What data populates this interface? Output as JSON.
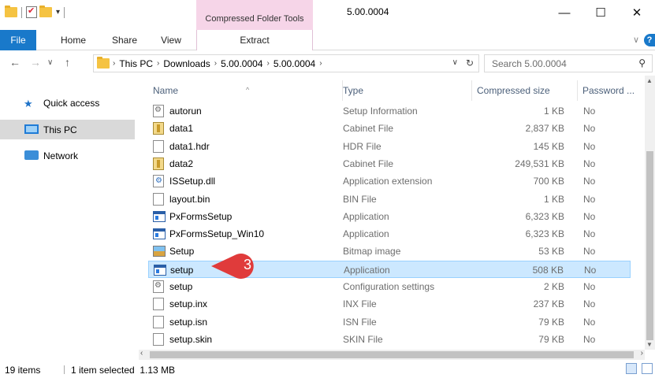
{
  "window": {
    "title": "5.00.0004",
    "context_tab": "Compressed Folder Tools",
    "minimize": "—",
    "maximize": "☐",
    "close": "✕"
  },
  "ribbon": {
    "tabs": [
      "File",
      "Home",
      "Share",
      "View",
      "Extract"
    ],
    "collapse_glyph": "∨",
    "help_glyph": "?"
  },
  "address": {
    "back": "←",
    "forward": "→",
    "recent": "∨",
    "up": "↑",
    "crumbs": [
      "This PC",
      "Downloads",
      "5.00.0004",
      "5.00.0004"
    ],
    "dropdown": "∨",
    "refresh": "↻"
  },
  "search": {
    "placeholder": "Search 5.00.0004",
    "glyph": "⚲"
  },
  "nav": {
    "quick_access": "Quick access",
    "this_pc": "This PC",
    "network": "Network"
  },
  "columns": {
    "name": "Name",
    "type": "Type",
    "size": "Compressed size",
    "password": "Password ..."
  },
  "files": [
    {
      "name": "autorun",
      "type": "Setup Information",
      "size": "1 KB",
      "password": "No",
      "icon": "settings-file-icon"
    },
    {
      "name": "data1",
      "type": "Cabinet File",
      "size": "2,837 KB",
      "password": "No",
      "icon": "cabinet-file-icon"
    },
    {
      "name": "data1.hdr",
      "type": "HDR File",
      "size": "145 KB",
      "password": "No",
      "icon": "blank-file-icon"
    },
    {
      "name": "data2",
      "type": "Cabinet File",
      "size": "249,531 KB",
      "password": "No",
      "icon": "cabinet-file-icon"
    },
    {
      "name": "ISSetup.dll",
      "type": "Application extension",
      "size": "700 KB",
      "password": "No",
      "icon": "dll-file-icon"
    },
    {
      "name": "layout.bin",
      "type": "BIN File",
      "size": "1 KB",
      "password": "No",
      "icon": "blank-file-icon"
    },
    {
      "name": "PxFormsSetup",
      "type": "Application",
      "size": "6,323 KB",
      "password": "No",
      "icon": "application-icon"
    },
    {
      "name": "PxFormsSetup_Win10",
      "type": "Application",
      "size": "6,323 KB",
      "password": "No",
      "icon": "application-icon"
    },
    {
      "name": "Setup",
      "type": "Bitmap image",
      "size": "53 KB",
      "password": "No",
      "icon": "bitmap-file-icon"
    },
    {
      "name": "setup",
      "type": "Application",
      "size": "508 KB",
      "password": "No",
      "icon": "application-icon",
      "selected": true
    },
    {
      "name": "setup",
      "type": "Configuration settings",
      "size": "2 KB",
      "password": "No",
      "icon": "settings-file-icon"
    },
    {
      "name": "setup.inx",
      "type": "INX File",
      "size": "237 KB",
      "password": "No",
      "icon": "blank-file-icon"
    },
    {
      "name": "setup.isn",
      "type": "ISN File",
      "size": "79 KB",
      "password": "No",
      "icon": "blank-file-icon"
    },
    {
      "name": "setup.skin",
      "type": "SKIN File",
      "size": "79 KB",
      "password": "No",
      "icon": "blank-file-icon"
    }
  ],
  "callout": {
    "number": "3",
    "color": "#e03b3b"
  },
  "status": {
    "item_count": "19 items",
    "selection": "1 item selected  1.13 MB"
  },
  "colors": {
    "file_tab": "#1979ca",
    "context_tab": "#f6d5e8",
    "selection": "#cce8ff"
  }
}
